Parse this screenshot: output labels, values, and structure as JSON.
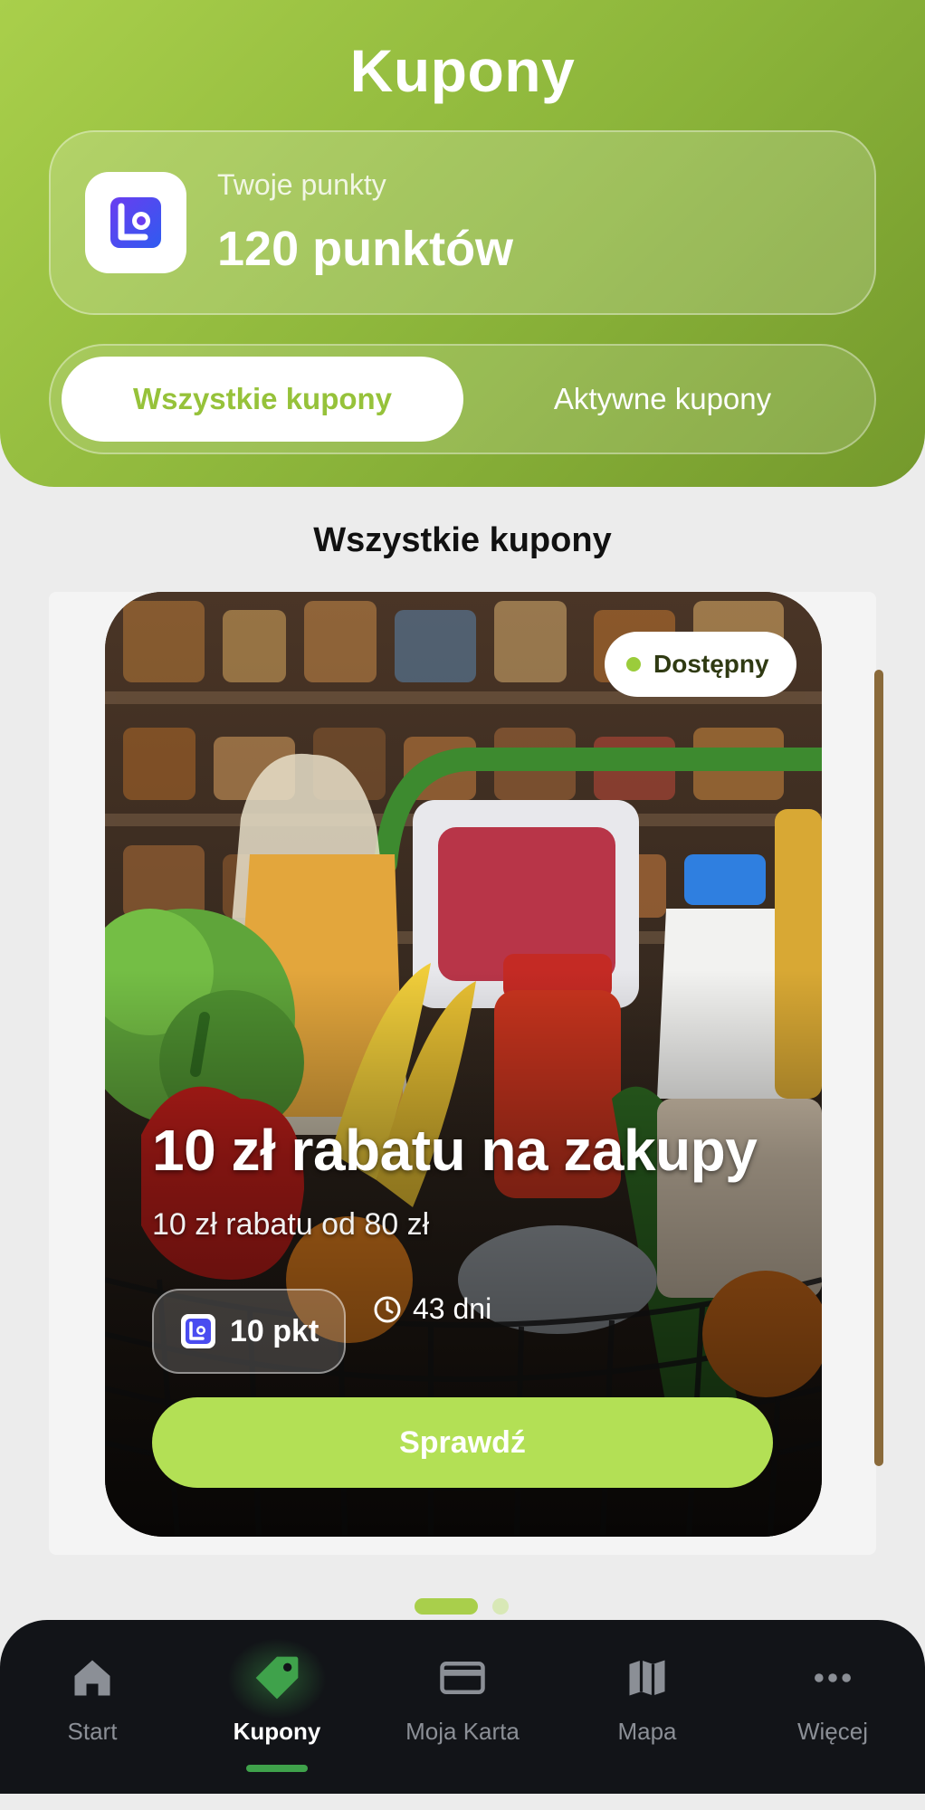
{
  "header": {
    "title": "Kupony",
    "points_label": "Twoje punkty",
    "points_value": "120 punktów",
    "tabs": [
      {
        "label": "Wszystkie kupony",
        "selected": true
      },
      {
        "label": "Aktywne kupony",
        "selected": false
      }
    ]
  },
  "section_title": "Wszystkie kupony",
  "coupon": {
    "status": "Dostępny",
    "title": "10 zł rabatu na zakupy",
    "description": "10 zł rabatu od 80 zł",
    "cost": "10 pkt",
    "expires_in": "43 dni",
    "button_label": "Sprawdź"
  },
  "pager": {
    "pages": 2,
    "current": 1
  },
  "nav": {
    "items": [
      {
        "label": "Start",
        "icon": "home-icon",
        "active": false
      },
      {
        "label": "Kupony",
        "icon": "tag-icon",
        "active": true
      },
      {
        "label": "Moja Karta",
        "icon": "card-icon",
        "active": false
      },
      {
        "label": "Mapa",
        "icon": "map-icon",
        "active": false
      },
      {
        "label": "Więcej",
        "icon": "more-icon",
        "active": false
      }
    ]
  },
  "colors": {
    "brand_green": "#96c23a",
    "button_green": "#b3e055",
    "nav_accent": "#3fa24b",
    "nav_bg": "#121418"
  }
}
